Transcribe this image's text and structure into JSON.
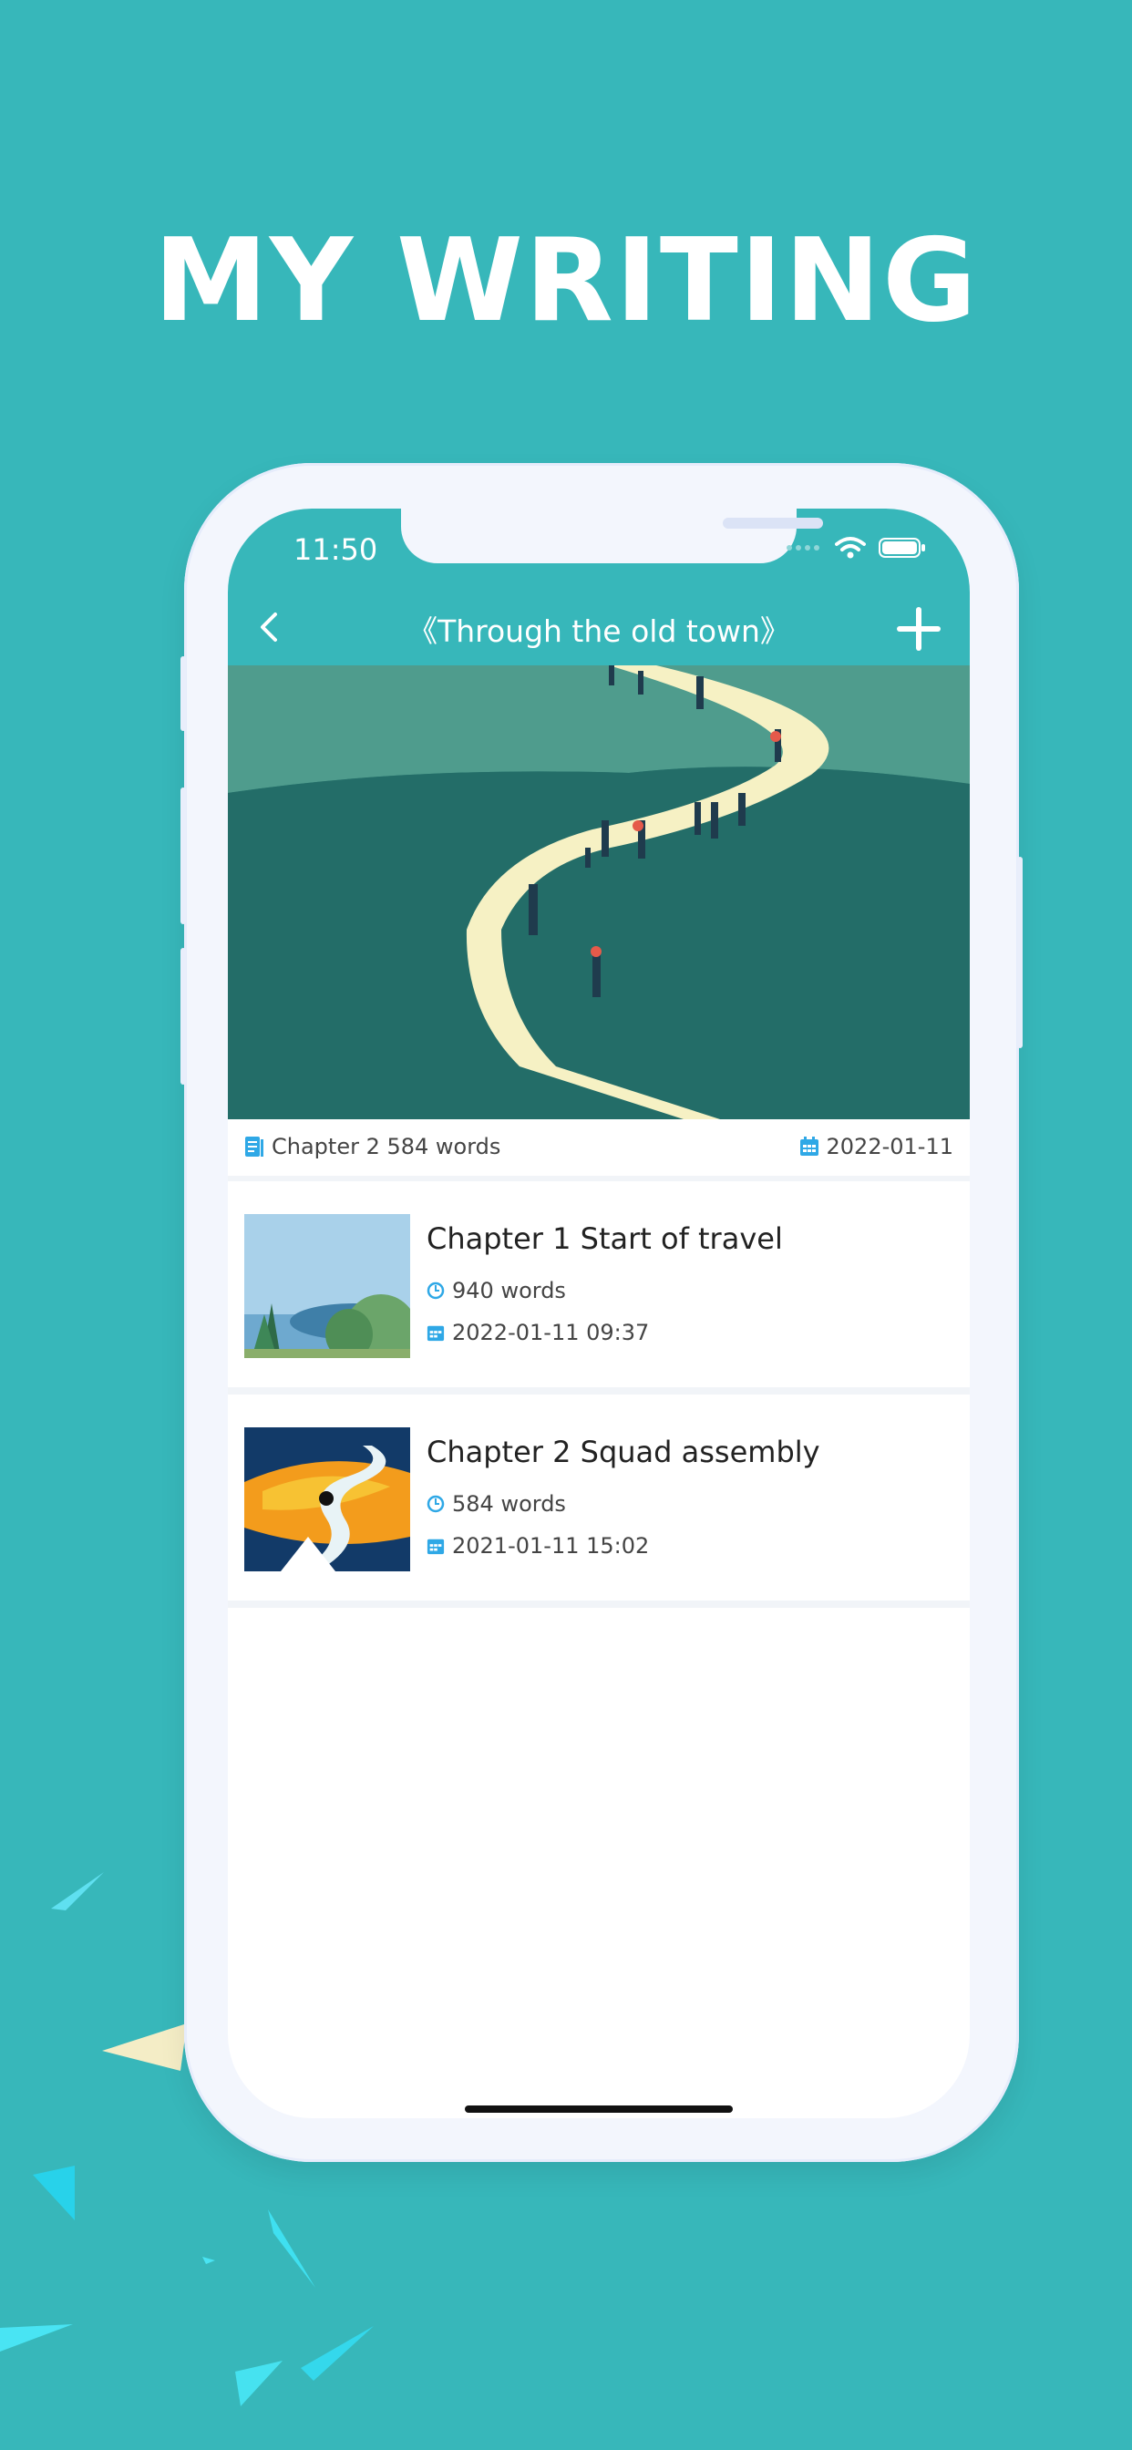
{
  "headline": "MY WRITING",
  "status": {
    "time": "11:50"
  },
  "nav": {
    "title": "《Through the old town》",
    "back_icon": "chevron-left-icon",
    "add_icon": "plus-icon"
  },
  "summary": {
    "chapter_words": "Chapter 2 584 words",
    "date": "2022-01-11"
  },
  "chapters": [
    {
      "title": "Chapter 1 Start of travel",
      "words": "940 words",
      "datetime": "2022-01-11 09:37"
    },
    {
      "title": "Chapter 2 Squad assembly",
      "words": "584 words",
      "datetime": "2021-01-11 15:02"
    }
  ],
  "colors": {
    "accent": "#37b7ba",
    "icon_blue": "#2fa8e6"
  }
}
